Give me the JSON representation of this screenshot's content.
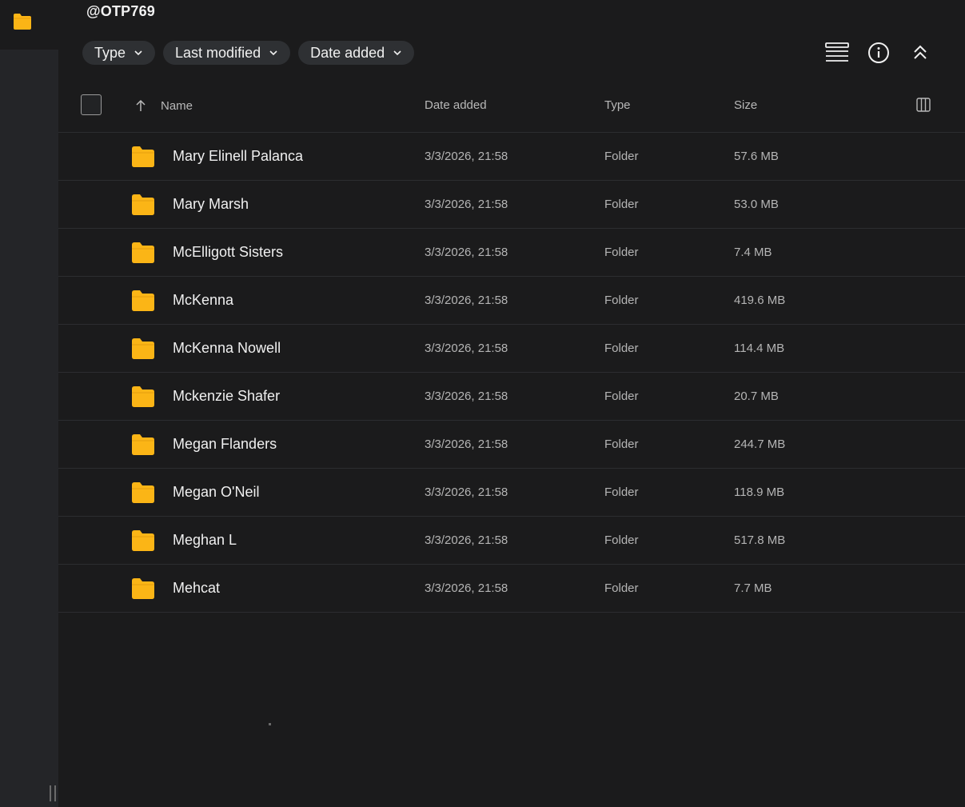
{
  "header": {
    "title": "@OTP769"
  },
  "filters": [
    {
      "label": "Type"
    },
    {
      "label": "Last modified"
    },
    {
      "label": "Date added"
    }
  ],
  "toolbar": {
    "icons": [
      "list-view-icon",
      "info-icon",
      "collapse-up-icon"
    ]
  },
  "table": {
    "columns": {
      "name": "Name",
      "date": "Date added",
      "type": "Type",
      "size": "Size"
    },
    "rows": [
      {
        "name": "Mary Elinell Palanca",
        "date": "3/3/2026, 21:58",
        "type": "Folder",
        "size": "57.6 MB"
      },
      {
        "name": "Mary Marsh",
        "date": "3/3/2026, 21:58",
        "type": "Folder",
        "size": "53.0 MB"
      },
      {
        "name": "McElligott Sisters",
        "date": "3/3/2026, 21:58",
        "type": "Folder",
        "size": "7.4 MB"
      },
      {
        "name": "McKenna",
        "date": "3/3/2026, 21:58",
        "type": "Folder",
        "size": "419.6 MB"
      },
      {
        "name": "McKenna Nowell",
        "date": "3/3/2026, 21:58",
        "type": "Folder",
        "size": "114.4 MB"
      },
      {
        "name": "Mckenzie Shafer",
        "date": "3/3/2026, 21:58",
        "type": "Folder",
        "size": "20.7 MB"
      },
      {
        "name": "Megan Flanders",
        "date": "3/3/2026, 21:58",
        "type": "Folder",
        "size": "244.7 MB"
      },
      {
        "name": "Megan O'Neil",
        "date": "3/3/2026, 21:58",
        "type": "Folder",
        "size": "118.9 MB"
      },
      {
        "name": "Meghan L",
        "date": "3/3/2026, 21:58",
        "type": "Folder",
        "size": "517.8 MB"
      },
      {
        "name": "Mehcat",
        "date": "3/3/2026, 21:58",
        "type": "Folder",
        "size": "7.7 MB"
      }
    ]
  },
  "colors": {
    "folder": "#fbb516",
    "background": "#1b1b1c",
    "rail": "#242528",
    "chip": "#2e3033"
  }
}
